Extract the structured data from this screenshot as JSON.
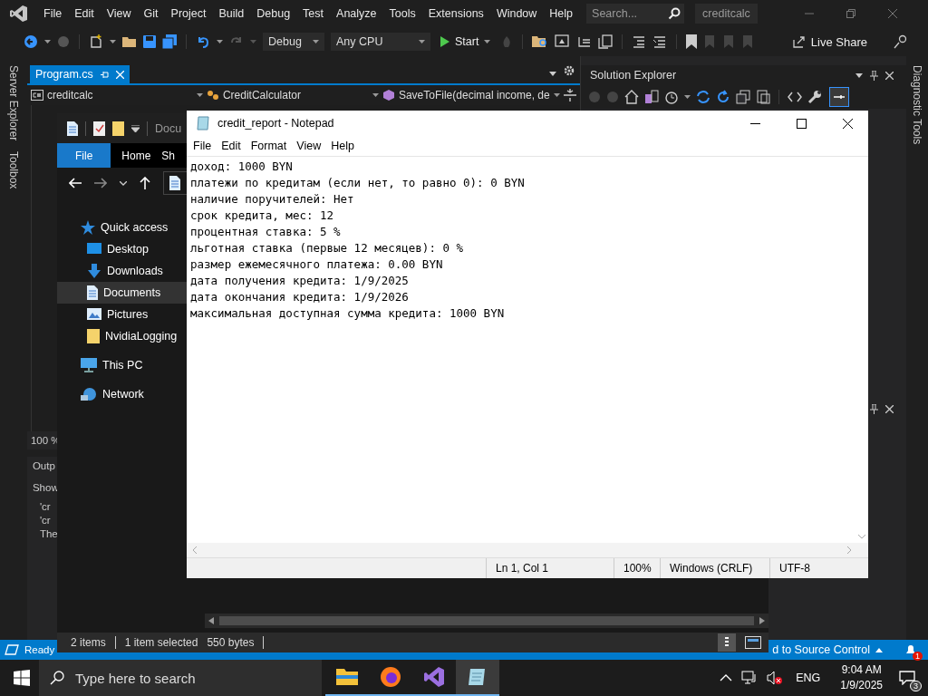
{
  "vs": {
    "menu": [
      "File",
      "Edit",
      "View",
      "Git",
      "Project",
      "Build",
      "Debug",
      "Test",
      "Analyze",
      "Tools",
      "Extensions",
      "Window",
      "Help"
    ],
    "search": {
      "placeholder": "Search..."
    },
    "solution_name": "creditcalc",
    "toolbar": {
      "configuration": "Debug",
      "platform": "Any CPU",
      "start": "Start",
      "live_share": "Live Share"
    },
    "left_tabs": [
      "Server Explorer",
      "Toolbox"
    ],
    "right_tabs": [
      "Diagnostic Tools"
    ],
    "editor_tabs": [
      {
        "label": "Program.cs",
        "selected": true
      }
    ],
    "navigation": [
      "creditcalc",
      "CreditCalculator",
      "SaveToFile(decimal income, de"
    ],
    "zoom": "100 %",
    "output": {
      "title": "Outp",
      "show_label": "Show",
      "lines": [
        "'cr",
        "'cr",
        "The"
      ]
    },
    "solution_explorer": {
      "title": "Solution Explorer"
    },
    "status_bar": {
      "state": "Ready",
      "source_control": "d to Source Control",
      "notifications": "1"
    }
  },
  "file_explorer": {
    "breadcrumb": "Docu",
    "ribbon_tabs": [
      {
        "label": "File",
        "selected": true
      },
      {
        "label": "Home",
        "selected": false
      },
      {
        "label": "Sh",
        "selected": false
      }
    ],
    "tree": [
      {
        "label": "Quick access",
        "kind": "star",
        "selected": false,
        "children": [
          {
            "label": "Desktop",
            "kind": "desktop",
            "selected": false
          },
          {
            "label": "Downloads",
            "kind": "download",
            "selected": false
          },
          {
            "label": "Documents",
            "kind": "document",
            "selected": true
          },
          {
            "label": "Pictures",
            "kind": "picture",
            "selected": false
          },
          {
            "label": "NvidiaLogging",
            "kind": "folder",
            "selected": false
          }
        ]
      },
      {
        "label": "This PC",
        "kind": "pc",
        "selected": false
      },
      {
        "label": "Network",
        "kind": "network",
        "selected": false
      }
    ],
    "status": [
      "2 items",
      "1 item selected",
      "550 bytes"
    ]
  },
  "notepad": {
    "title": "credit_report - Notepad",
    "menu": [
      "File",
      "Edit",
      "Format",
      "View",
      "Help"
    ],
    "lines": [
      "доход: 1000 BYN",
      "платежи по кредитам (если нет, то равно 0): 0 BYN",
      "наличие поручителей: Нет",
      "срок кредита, мес: 12",
      "процентная ставка: 5 %",
      "льготная ставка (первые 12 месяцев): 0 %",
      "размер ежемесячного платежа: 0.00 BYN",
      "дата получения кредита: 1/9/2025",
      "дата окончания кредита: 1/9/2026",
      "максимальная доступная сумма кредита: 1000 BYN"
    ],
    "status": {
      "position": "Ln 1, Col 1",
      "zoom": "100%",
      "line_endings": "Windows (CRLF)",
      "encoding": "UTF-8"
    }
  },
  "taskbar": {
    "search": {
      "placeholder": "Type here to search"
    },
    "apps": [
      {
        "kind": "folder",
        "active": false
      },
      {
        "kind": "browser",
        "active": false
      },
      {
        "kind": "ide",
        "active": false
      },
      {
        "kind": "notepad",
        "active": true
      }
    ],
    "language": "ENG",
    "time": "9:04 AM",
    "date": "1/9/2025",
    "notifications": "3"
  }
}
